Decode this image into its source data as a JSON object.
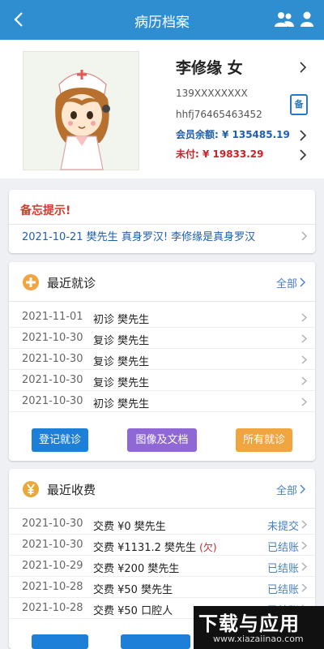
{
  "header": {
    "title": "病历档案"
  },
  "patient": {
    "name": "李修缘 女",
    "phone": "139XXXXXXXX",
    "id_code": "hhfj76465463452",
    "badge": "备",
    "balance": "会员余额: ¥ 135485.19",
    "unpaid": "未付: ¥ 19833.29"
  },
  "memo": {
    "title": "备忘提示!",
    "text": "2021-10-21  樊先生 真身罗汉!  李修缘是真身罗汉"
  },
  "visits": {
    "title": "最近就诊",
    "all_label": "全部",
    "rows": [
      {
        "date": "2021-11-01",
        "desc": "初诊 樊先生"
      },
      {
        "date": "2021-10-30",
        "desc": "复诊 樊先生"
      },
      {
        "date": "2021-10-30",
        "desc": "复诊 樊先生"
      },
      {
        "date": "2021-10-30",
        "desc": "复诊 樊先生"
      },
      {
        "date": "2021-10-30",
        "desc": "初诊 樊先生"
      }
    ],
    "buttons": {
      "register": "登记就诊",
      "images": "图像及文档",
      "all_visits": "所有就诊"
    }
  },
  "payments": {
    "title": "最近收费",
    "all_label": "全部",
    "rows": [
      {
        "date": "2021-10-30",
        "desc": "交费 ¥0 樊先生",
        "owe": "",
        "status": "未提交"
      },
      {
        "date": "2021-10-30",
        "desc": "交费 ¥1131.2 樊先生",
        "owe": "(欠)",
        "status": "已结账"
      },
      {
        "date": "2021-10-29",
        "desc": "交费 ¥200 樊先生",
        "owe": "",
        "status": "已结账"
      },
      {
        "date": "2021-10-28",
        "desc": "交费 ¥50 樊先生",
        "owe": "",
        "status": "已结账"
      },
      {
        "date": "2021-10-28",
        "desc": "交费 ¥50 口腔人",
        "owe": "",
        "status": "已结账"
      }
    ]
  },
  "watermark": {
    "line1": "下载与应用",
    "line2": "www.xiazaiinao.com"
  },
  "colors": {
    "header_bg": "#2f8ed0",
    "balance": "#1f5fae",
    "unpaid": "#c8232c",
    "btn_blue": "#1e7fd8",
    "btn_purple": "#8f68d6",
    "btn_orange": "#f0a540"
  }
}
